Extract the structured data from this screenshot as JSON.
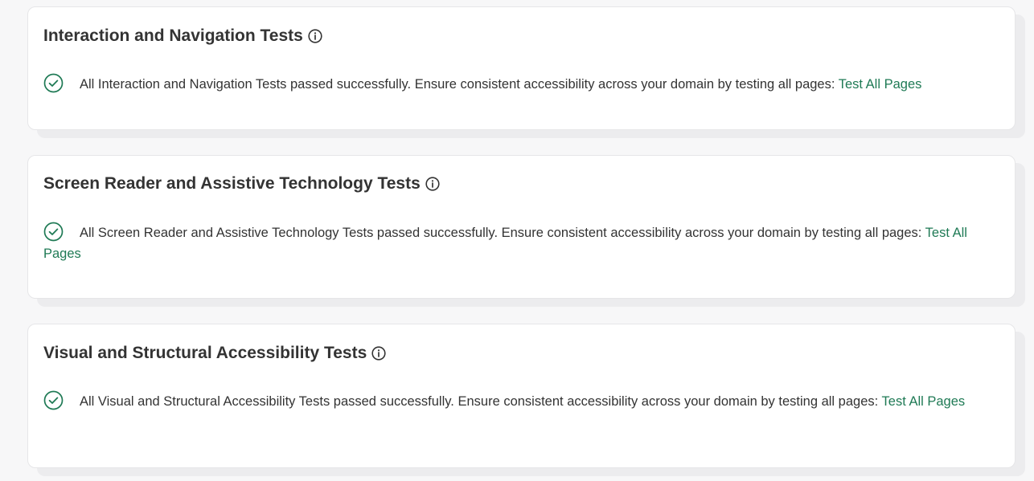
{
  "colors": {
    "accent": "#1f7a55",
    "text": "#333333",
    "card_bg": "#ffffff",
    "page_bg": "#f7f7f8"
  },
  "sections": [
    {
      "title": "Interaction and Navigation Tests",
      "icon": "info-icon",
      "status_icon": "check-circle-icon",
      "message": "All Interaction and Navigation Tests passed successfully. Ensure consistent accessibility across your domain by testing all pages: ",
      "link_label": "Test All Pages"
    },
    {
      "title": "Screen Reader and Assistive Technology Tests",
      "icon": "info-icon",
      "status_icon": "check-circle-icon",
      "message": "All Screen Reader and Assistive Technology Tests passed successfully. Ensure consistent accessibility across your domain by testing all pages: ",
      "link_label": "Test All Pages"
    },
    {
      "title": "Visual and Structural Accessibility Tests",
      "icon": "info-icon",
      "status_icon": "check-circle-icon",
      "message": "All Visual and Structural Accessibility Tests passed successfully. Ensure consistent accessibility across your domain by testing all pages: ",
      "link_label": "Test All Pages"
    }
  ]
}
